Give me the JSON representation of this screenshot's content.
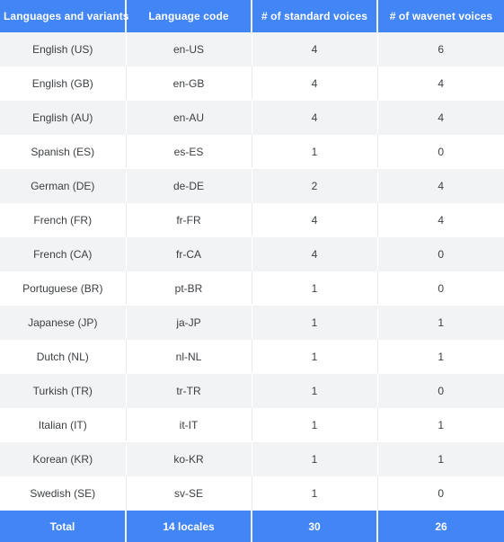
{
  "table": {
    "columns": [
      {
        "key": "language",
        "label": "Languages and variants"
      },
      {
        "key": "code",
        "label": "Language code"
      },
      {
        "key": "standard",
        "label": "# of standard voices"
      },
      {
        "key": "wavenet",
        "label": "# of wavenet voices"
      }
    ],
    "rows": [
      {
        "language": "English (US)",
        "code": "en-US",
        "standard": "4",
        "wavenet": "6"
      },
      {
        "language": "English (GB)",
        "code": "en-GB",
        "standard": "4",
        "wavenet": "4"
      },
      {
        "language": "English (AU)",
        "code": "en-AU",
        "standard": "4",
        "wavenet": "4"
      },
      {
        "language": "Spanish (ES)",
        "code": "es-ES",
        "standard": "1",
        "wavenet": "0"
      },
      {
        "language": "German (DE)",
        "code": "de-DE",
        "standard": "2",
        "wavenet": "4"
      },
      {
        "language": "French (FR)",
        "code": "fr-FR",
        "standard": "4",
        "wavenet": "4"
      },
      {
        "language": "French (CA)",
        "code": "fr-CA",
        "standard": "4",
        "wavenet": "0"
      },
      {
        "language": "Portuguese (BR)",
        "code": "pt-BR",
        "standard": "1",
        "wavenet": "0"
      },
      {
        "language": "Japanese (JP)",
        "code": "ja-JP",
        "standard": "1",
        "wavenet": "1"
      },
      {
        "language": "Dutch (NL)",
        "code": "nl-NL",
        "standard": "1",
        "wavenet": "1"
      },
      {
        "language": "Turkish (TR)",
        "code": "tr-TR",
        "standard": "1",
        "wavenet": "0"
      },
      {
        "language": "Italian (IT)",
        "code": "it-IT",
        "standard": "1",
        "wavenet": "1"
      },
      {
        "language": "Korean (KR)",
        "code": "ko-KR",
        "standard": "1",
        "wavenet": "1"
      },
      {
        "language": "Swedish (SE)",
        "code": "sv-SE",
        "standard": "1",
        "wavenet": "0"
      }
    ],
    "total": {
      "language": "Total",
      "code": "14 locales",
      "standard": "30",
      "wavenet": "26"
    }
  },
  "colors": {
    "header_blue": "#4285f4",
    "total_blue": "#4285f4",
    "stripe_gray": "#f1f3f4",
    "row_white": "#ffffff",
    "body_text": "#3c4043",
    "header_text": "#ffffff",
    "divider": "#e8eaed"
  }
}
